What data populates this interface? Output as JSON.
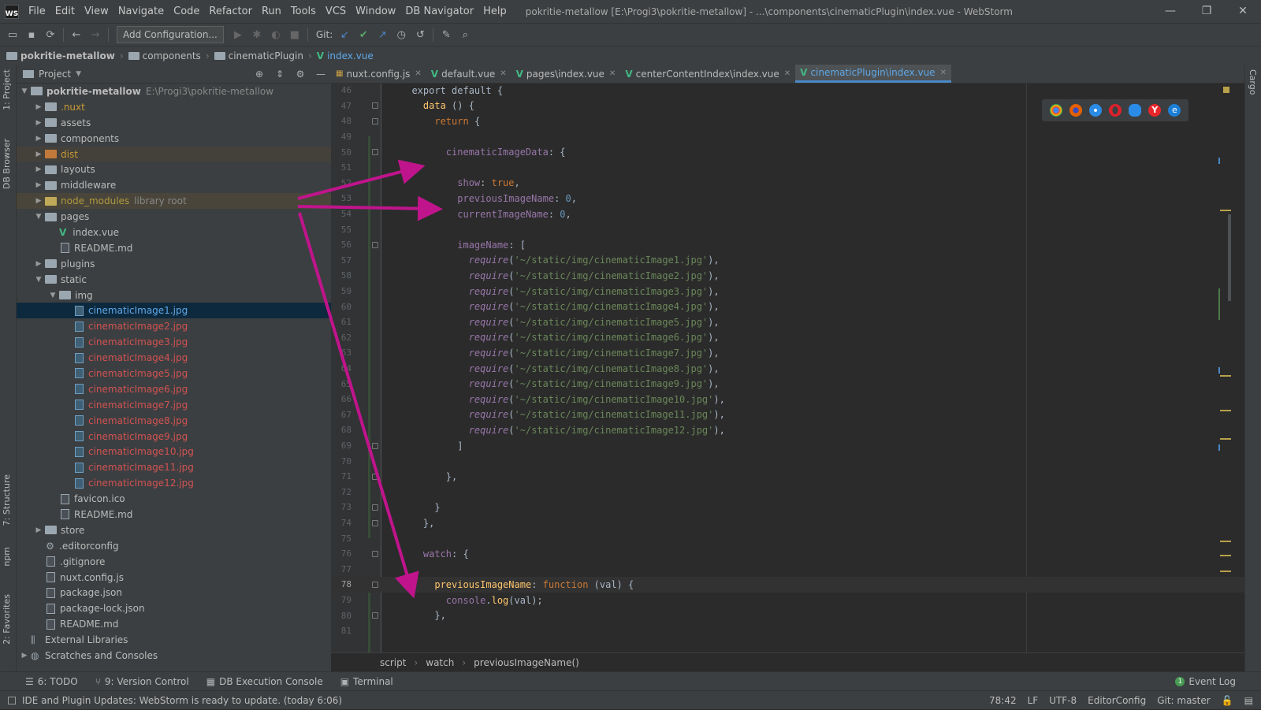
{
  "menubar": {
    "logo": "WS",
    "items": [
      "File",
      "Edit",
      "View",
      "Navigate",
      "Code",
      "Refactor",
      "Run",
      "Tools",
      "VCS",
      "Window",
      "DB Navigator",
      "Help"
    ],
    "title": "pokritie-metallow [E:\\Progi3\\pokritie-metallow] - ...\\components\\cinematicPlugin\\index.vue - WebStorm"
  },
  "toolbar": {
    "add_config": "Add Configuration...",
    "git_label": "Git:"
  },
  "breadcrumbs": [
    "pokritie-metallow",
    "components",
    "cinematicPlugin",
    "index.vue"
  ],
  "project": {
    "title": "Project",
    "root_name": "pokritie-metallow",
    "root_path": "E:\\Progi3\\pokritie-metallow",
    "items": [
      {
        "label": ".nuxt",
        "indent": 1,
        "type": "folder",
        "tw": "▶",
        "cls": "t-orange"
      },
      {
        "label": "assets",
        "indent": 1,
        "type": "folder",
        "tw": "▶",
        "cls": ""
      },
      {
        "label": "components",
        "indent": 1,
        "type": "folder",
        "tw": "▶",
        "cls": ""
      },
      {
        "label": "dist",
        "indent": 1,
        "type": "folder",
        "tw": "▶",
        "cls": "t-orange",
        "row": "excl",
        "fcls": "orange"
      },
      {
        "label": "layouts",
        "indent": 1,
        "type": "folder",
        "tw": "▶",
        "cls": ""
      },
      {
        "label": "middleware",
        "indent": 1,
        "type": "folder",
        "tw": "▶",
        "cls": ""
      },
      {
        "label": "node_modules",
        "indent": 1,
        "type": "folder",
        "tw": "▶",
        "cls": "t-node",
        "extra": "library root",
        "row": "hl",
        "fcls": "yellow"
      },
      {
        "label": "pages",
        "indent": 1,
        "type": "folder",
        "tw": "▼",
        "cls": ""
      },
      {
        "label": "index.vue",
        "indent": 2,
        "type": "vue",
        "tw": "",
        "cls": ""
      },
      {
        "label": "README.md",
        "indent": 2,
        "type": "file",
        "tw": "",
        "cls": ""
      },
      {
        "label": "plugins",
        "indent": 1,
        "type": "folder",
        "tw": "▶",
        "cls": ""
      },
      {
        "label": "static",
        "indent": 1,
        "type": "folder",
        "tw": "▼",
        "cls": ""
      },
      {
        "label": "img",
        "indent": 2,
        "type": "folder",
        "tw": "▼",
        "cls": ""
      },
      {
        "label": "cinematicImage1.jpg",
        "indent": 3,
        "type": "img",
        "tw": "",
        "cls": "t-blue",
        "row": "sel"
      },
      {
        "label": "cinematicImage2.jpg",
        "indent": 3,
        "type": "img",
        "tw": "",
        "cls": "t-red"
      },
      {
        "label": "cinematicImage3.jpg",
        "indent": 3,
        "type": "img",
        "tw": "",
        "cls": "t-red"
      },
      {
        "label": "cinematicImage4.jpg",
        "indent": 3,
        "type": "img",
        "tw": "",
        "cls": "t-red"
      },
      {
        "label": "cinematicImage5.jpg",
        "indent": 3,
        "type": "img",
        "tw": "",
        "cls": "t-red"
      },
      {
        "label": "cinematicImage6.jpg",
        "indent": 3,
        "type": "img",
        "tw": "",
        "cls": "t-red"
      },
      {
        "label": "cinematicImage7.jpg",
        "indent": 3,
        "type": "img",
        "tw": "",
        "cls": "t-red"
      },
      {
        "label": "cinematicImage8.jpg",
        "indent": 3,
        "type": "img",
        "tw": "",
        "cls": "t-red"
      },
      {
        "label": "cinematicImage9.jpg",
        "indent": 3,
        "type": "img",
        "tw": "",
        "cls": "t-red"
      },
      {
        "label": "cinematicImage10.jpg",
        "indent": 3,
        "type": "img",
        "tw": "",
        "cls": "t-red"
      },
      {
        "label": "cinematicImage11.jpg",
        "indent": 3,
        "type": "img",
        "tw": "",
        "cls": "t-red"
      },
      {
        "label": "cinematicImage12.jpg",
        "indent": 3,
        "type": "img",
        "tw": "",
        "cls": "t-red"
      },
      {
        "label": "favicon.ico",
        "indent": 2,
        "type": "file",
        "tw": "",
        "cls": ""
      },
      {
        "label": "README.md",
        "indent": 2,
        "type": "file",
        "tw": "",
        "cls": ""
      },
      {
        "label": "store",
        "indent": 1,
        "type": "folder",
        "tw": "▶",
        "cls": ""
      },
      {
        "label": ".editorconfig",
        "indent": 1,
        "type": "gear",
        "tw": "",
        "cls": ""
      },
      {
        "label": ".gitignore",
        "indent": 1,
        "type": "file",
        "tw": "",
        "cls": ""
      },
      {
        "label": "nuxt.config.js",
        "indent": 1,
        "type": "file",
        "tw": "",
        "cls": ""
      },
      {
        "label": "package.json",
        "indent": 1,
        "type": "file",
        "tw": "",
        "cls": ""
      },
      {
        "label": "package-lock.json",
        "indent": 1,
        "type": "file",
        "tw": "",
        "cls": ""
      },
      {
        "label": "README.md",
        "indent": 1,
        "type": "file",
        "tw": "",
        "cls": ""
      },
      {
        "label": "External Libraries",
        "indent": 0,
        "type": "lib",
        "tw": "",
        "cls": ""
      },
      {
        "label": "Scratches and Consoles",
        "indent": 0,
        "type": "scratch",
        "tw": "▶",
        "cls": ""
      }
    ]
  },
  "left_tabs": [
    "1: Project",
    "DB Browser",
    "7: Structure",
    "npm",
    "2: Favorites"
  ],
  "right_tabs": [
    "Cargo"
  ],
  "editor_tabs": [
    {
      "label": "nuxt.config.js",
      "type": "js",
      "active": false
    },
    {
      "label": "default.vue",
      "type": "vue",
      "active": false
    },
    {
      "label": "pages\\index.vue",
      "type": "vue",
      "active": false
    },
    {
      "label": "centerContentIndex\\index.vue",
      "type": "vue",
      "active": false
    },
    {
      "label": "cinematicPlugin\\index.vue",
      "type": "vue",
      "active": true
    }
  ],
  "code": {
    "first_line": 46,
    "current_line": 78,
    "lines": [
      [
        [
          "  export default {",
          "c"
        ]
      ],
      [
        [
          "    ",
          "c"
        ],
        [
          "data",
          "f"
        ],
        [
          " () {",
          "c"
        ]
      ],
      [
        [
          "      ",
          "c"
        ],
        [
          "return",
          "k"
        ],
        [
          " {",
          "c"
        ]
      ],
      [
        [
          "",
          "c"
        ]
      ],
      [
        [
          "        ",
          "c"
        ],
        [
          "cinematicImageData",
          "p"
        ],
        [
          ": {",
          "c"
        ]
      ],
      [
        [
          "",
          "c"
        ]
      ],
      [
        [
          "          ",
          "c"
        ],
        [
          "show",
          "p"
        ],
        [
          ": ",
          "c"
        ],
        [
          "true",
          "k"
        ],
        [
          ",",
          "c"
        ]
      ],
      [
        [
          "          ",
          "c"
        ],
        [
          "previousImageName",
          "p"
        ],
        [
          ": ",
          "c"
        ],
        [
          "0",
          "n"
        ],
        [
          ",",
          "c"
        ]
      ],
      [
        [
          "          ",
          "c"
        ],
        [
          "currentImageName",
          "p"
        ],
        [
          ": ",
          "c"
        ],
        [
          "0",
          "n"
        ],
        [
          ",",
          "c"
        ]
      ],
      [
        [
          "",
          "c"
        ]
      ],
      [
        [
          "          ",
          "c"
        ],
        [
          "imageName",
          "p"
        ],
        [
          ": [",
          "c"
        ]
      ],
      [
        [
          "            ",
          "c"
        ],
        [
          "require",
          "it"
        ],
        [
          "(",
          "c"
        ],
        [
          "'~/static/img/cinematicImage1.jpg'",
          "s"
        ],
        [
          "),",
          "c"
        ]
      ],
      [
        [
          "            ",
          "c"
        ],
        [
          "require",
          "it"
        ],
        [
          "(",
          "c"
        ],
        [
          "'~/static/img/cinematicImage2.jpg'",
          "s"
        ],
        [
          "),",
          "c"
        ]
      ],
      [
        [
          "            ",
          "c"
        ],
        [
          "require",
          "it"
        ],
        [
          "(",
          "c"
        ],
        [
          "'~/static/img/cinematicImage3.jpg'",
          "s"
        ],
        [
          "),",
          "c"
        ]
      ],
      [
        [
          "            ",
          "c"
        ],
        [
          "require",
          "it"
        ],
        [
          "(",
          "c"
        ],
        [
          "'~/static/img/cinematicImage4.jpg'",
          "s"
        ],
        [
          "),",
          "c"
        ]
      ],
      [
        [
          "            ",
          "c"
        ],
        [
          "require",
          "it"
        ],
        [
          "(",
          "c"
        ],
        [
          "'~/static/img/cinematicImage5.jpg'",
          "s"
        ],
        [
          "),",
          "c"
        ]
      ],
      [
        [
          "            ",
          "c"
        ],
        [
          "require",
          "it"
        ],
        [
          "(",
          "c"
        ],
        [
          "'~/static/img/cinematicImage6.jpg'",
          "s"
        ],
        [
          "),",
          "c"
        ]
      ],
      [
        [
          "            ",
          "c"
        ],
        [
          "require",
          "it"
        ],
        [
          "(",
          "c"
        ],
        [
          "'~/static/img/cinematicImage7.jpg'",
          "s"
        ],
        [
          "),",
          "c"
        ]
      ],
      [
        [
          "            ",
          "c"
        ],
        [
          "require",
          "it"
        ],
        [
          "(",
          "c"
        ],
        [
          "'~/static/img/cinematicImage8.jpg'",
          "s"
        ],
        [
          "),",
          "c"
        ]
      ],
      [
        [
          "            ",
          "c"
        ],
        [
          "require",
          "it"
        ],
        [
          "(",
          "c"
        ],
        [
          "'~/static/img/cinematicImage9.jpg'",
          "s"
        ],
        [
          "),",
          "c"
        ]
      ],
      [
        [
          "            ",
          "c"
        ],
        [
          "require",
          "it"
        ],
        [
          "(",
          "c"
        ],
        [
          "'~/static/img/cinematicImage10.jpg'",
          "s"
        ],
        [
          "),",
          "c"
        ]
      ],
      [
        [
          "            ",
          "c"
        ],
        [
          "require",
          "it"
        ],
        [
          "(",
          "c"
        ],
        [
          "'~/static/img/cinematicImage11.jpg'",
          "s"
        ],
        [
          "),",
          "c"
        ]
      ],
      [
        [
          "            ",
          "c"
        ],
        [
          "require",
          "it"
        ],
        [
          "(",
          "c"
        ],
        [
          "'~/static/img/cinematicImage12.jpg'",
          "s"
        ],
        [
          "),",
          "c"
        ]
      ],
      [
        [
          "          ]",
          "c"
        ]
      ],
      [
        [
          "",
          "c"
        ]
      ],
      [
        [
          "        },",
          "c"
        ]
      ],
      [
        [
          "",
          "c"
        ]
      ],
      [
        [
          "      }",
          "c"
        ]
      ],
      [
        [
          "    },",
          "c"
        ]
      ],
      [
        [
          "",
          "c"
        ]
      ],
      [
        [
          "    ",
          "c"
        ],
        [
          "watch",
          "p"
        ],
        [
          ": {",
          "c"
        ]
      ],
      [
        [
          "",
          "c"
        ]
      ],
      [
        [
          "      ",
          "c"
        ],
        [
          "previousImageName",
          "f"
        ],
        [
          ": ",
          "c"
        ],
        [
          "function",
          "k"
        ],
        [
          " (val) {",
          "c"
        ]
      ],
      [
        [
          "        ",
          "c"
        ],
        [
          "console",
          "p"
        ],
        [
          ".",
          "c"
        ],
        [
          "log",
          "fn"
        ],
        [
          "(val);",
          "c"
        ]
      ],
      [
        [
          "      },",
          "c"
        ]
      ],
      [
        [
          "",
          "c"
        ]
      ]
    ]
  },
  "editor_breadcrumb": [
    "script",
    "watch",
    "previousImageName()"
  ],
  "tool_windows": [
    {
      "icon": "☰",
      "label": "6: TODO"
    },
    {
      "icon": "⑂",
      "label": "9: Version Control"
    },
    {
      "icon": "▦",
      "label": "DB Execution Console"
    },
    {
      "icon": "▣",
      "label": "Terminal"
    }
  ],
  "event_log": {
    "badge": "1",
    "label": "Event Log"
  },
  "status": {
    "message": "IDE and Plugin Updates: WebStorm is ready to update. (today 6:06)",
    "position": "78:42",
    "line_sep": "LF",
    "encoding": "UTF-8",
    "editorconfig": "EditorConfig",
    "git": "Git: master"
  },
  "colors": {
    "annotation_arrow": "#c0148c",
    "accent": "#4a88c7"
  }
}
